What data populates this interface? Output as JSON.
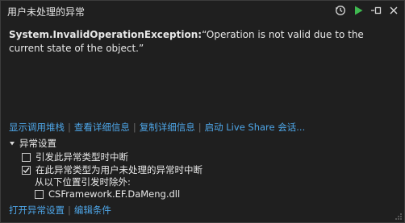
{
  "title": "用户未处理的异常",
  "message": {
    "exception_type": "System.InvalidOperationException:",
    "text": "“Operation is not valid due to the current state of the object.”"
  },
  "links": [
    "显示调用堆栈",
    "查看详细信息",
    "复制详细信息",
    "启动 Live Share 会话..."
  ],
  "settings": {
    "header": "异常设置",
    "option1": {
      "label": "引发此异常类型时中断",
      "checked": false
    },
    "option2": {
      "label": "在此异常类型为用户未处理的异常时中断",
      "checked": true
    },
    "except_label": "从以下位置引发时除外:",
    "except_item": {
      "label": "CSFramework.EF.DaMeng.dll",
      "checked": false
    }
  },
  "bottom_links": [
    "打开异常设置",
    "编辑条件"
  ],
  "colors": {
    "background": "#1f1f1f",
    "link": "#4ea6e8",
    "play": "#3fb950"
  }
}
